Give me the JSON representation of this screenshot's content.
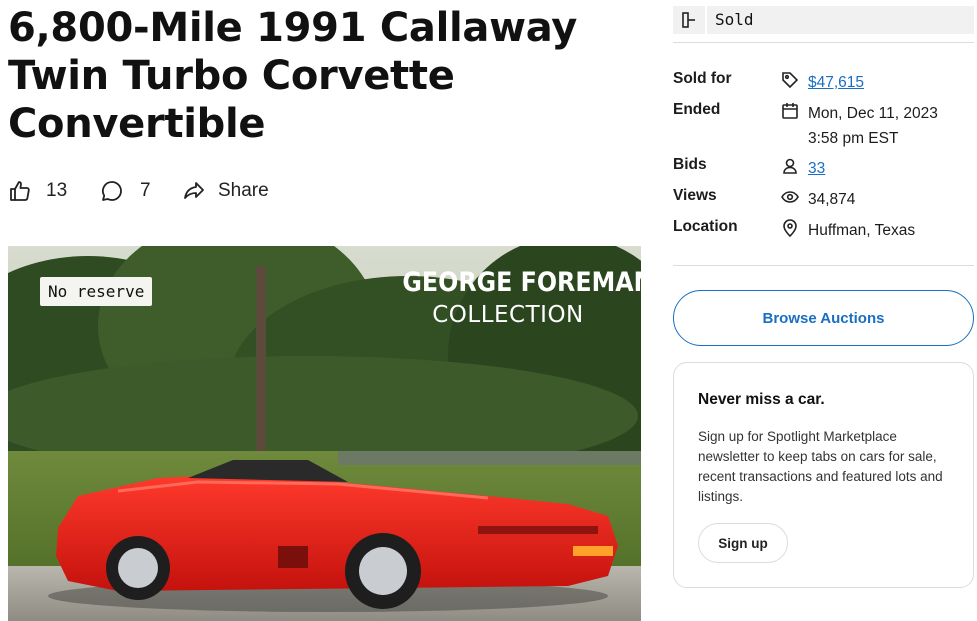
{
  "listing": {
    "title_line1": "6,800-Mile 1991 Callaway",
    "title_line2": "Twin Turbo Corvette",
    "title_line3": "Convertible"
  },
  "actions": {
    "likes_count": "13",
    "comments_count": "7",
    "share_label": "Share"
  },
  "hero": {
    "reserve_badge": "No reserve",
    "collection_line1": "GEORGE FOREMAN",
    "collection_line2": "COLLECTION"
  },
  "status": {
    "label": "Sold",
    "icon": "gavel-icon"
  },
  "details": {
    "sold_for_label": "Sold for",
    "sold_for_value": "$47,615",
    "ended_label": "Ended",
    "ended_date": "Mon, Dec 11, 2023",
    "ended_time": "3:58 pm EST",
    "bids_label": "Bids",
    "bids_value": "33",
    "views_label": "Views",
    "views_value": "34,874",
    "location_label": "Location",
    "location_value": "Huffman, Texas"
  },
  "browse": {
    "button_label": "Browse Auctions"
  },
  "newsletter": {
    "title": "Never miss a car.",
    "body": "Sign up for Spotlight Marketplace newsletter to keep tabs on cars for sale, recent transactions and featured lots and listings.",
    "button_label": "Sign up"
  },
  "colors": {
    "link": "#1a6fc2",
    "car_red": "#e0201b",
    "panel_grey": "#f1f1f1"
  }
}
